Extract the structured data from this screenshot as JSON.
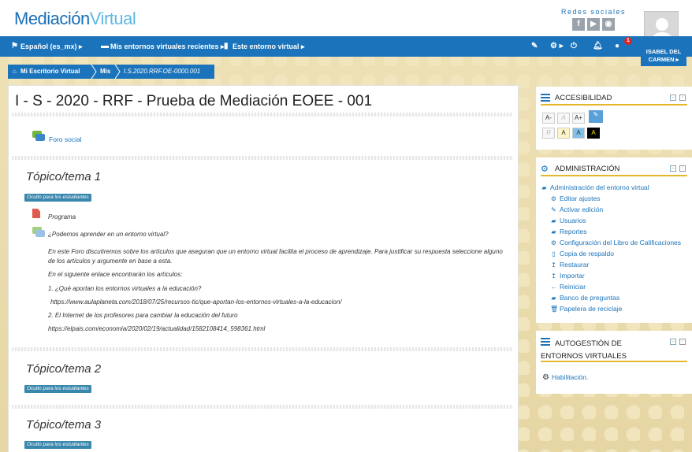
{
  "header": {
    "logo_part1": "Mediación",
    "logo_part2": "Virtual",
    "social_title": "Redes sociales",
    "social_icons": [
      "facebook-icon",
      "youtube-icon",
      "other-social-icon"
    ]
  },
  "nav": {
    "language": "Español (es_mx) ▸",
    "recent": "Mis entornos virtuales recientes ▸",
    "this_env": "Este entorno virtual ▸",
    "notification_count": "1",
    "user_name_line1": "ISABEL DEL",
    "user_name_line2": "CARMEN ▸"
  },
  "breadcrumb": {
    "home": "Mi Escritorio Virtual",
    "mis": "Mis",
    "course": "I.S.2020.RRF.OE-0000.001"
  },
  "course": {
    "title": "I - S - 2020 - RRF - Prueba de Mediación EOEE - 001",
    "forum_link": "Foro social",
    "hidden_label": "Oculto para los estudiantes",
    "topics": [
      {
        "title": "Tópico/tema 1"
      },
      {
        "title": "Tópico/tema 2"
      },
      {
        "title": "Tópico/tema 3"
      }
    ],
    "topic1_items": {
      "programa": "Programa",
      "question": "¿Podemos aprender en un entorno virtual?",
      "para1": "En este Foro discutiremos sobre los artículos que aseguran que un entorno virtual facilita el proceso de aprendizaje. Para justificar su respuesta seleccione alguno de los artículos y argumente en base a esta.",
      "para2": "En el siguiente enlace encontrarán los artículos:",
      "para3": "1. ¿Qué aportan los entornos virtuales a la educación?",
      "url1": "https://www.aulaplaneta.com/2018/07/25/recursos-tic/que-aportan-los-entornos-virtuales-a-la-educacion/",
      "para4": "2. El Internet de los profesores para cambiar la educación del futuro",
      "url2": "https://elpais.com/economia/2020/02/19/actualidad/1582108414_598361.html"
    }
  },
  "accesibilidad": {
    "title": "ACCESIBILIDAD",
    "buttons_row1": [
      "A-",
      "A",
      "A+"
    ],
    "buttons_row2": [
      "R",
      "A",
      "A",
      "A"
    ]
  },
  "administracion": {
    "title": "ADMINISTRACIÓN",
    "root": "Administración del entorno virtual",
    "items": [
      "Editar ajustes",
      "Activar edición",
      "Usuarios",
      "Reportes",
      "Configuración del Libro de Calificaciones",
      "Copia de respaldo",
      "Restaurar",
      "Importar",
      "Reiniciar",
      "Banco de preguntas",
      "Papelera de reciclaje"
    ]
  },
  "autogestion": {
    "title_line1": "AUTOGESTIÓN DE",
    "title_line2": "ENTORNOS VIRTUALES",
    "item": "Habilitación."
  },
  "colors": {
    "primary": "#1b74bb",
    "accent": "#e4b82b",
    "hidden_tag": "#3a87ad",
    "badge": "#e02424"
  }
}
